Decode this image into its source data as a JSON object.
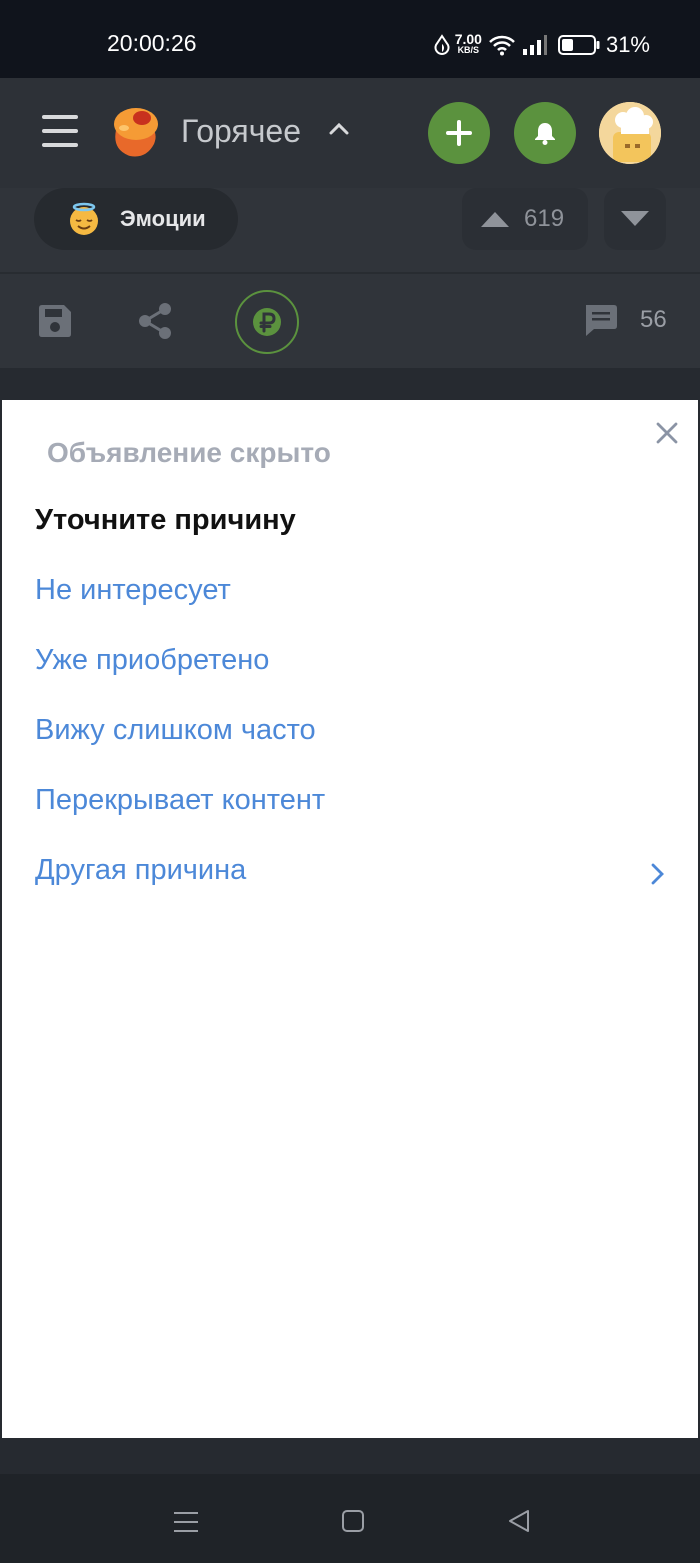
{
  "status_bar": {
    "time": "20:00:26",
    "net_speed_value": "7.00",
    "net_speed_unit": "KB/S",
    "battery_percent": "31%",
    "icons": [
      "data-saver-icon",
      "wifi-icon",
      "signal-icon",
      "battery-icon"
    ]
  },
  "header": {
    "menu_icon": "hamburger-icon",
    "logo_icon": "pikabu-logo-icon",
    "title": "Горячее",
    "title_icon": "chevron-up-icon",
    "add_icon": "plus-icon",
    "notifications_icon": "bell-icon",
    "avatar_icon": "user-avatar-icon",
    "accent_color": "#5b923e"
  },
  "post": {
    "tag": {
      "emoji_icon": "angel-face-icon",
      "label": "Эмоции"
    },
    "rating": "619",
    "actions": {
      "save_icon": "save-icon",
      "share_icon": "share-icon",
      "donate_icon": "ruble-icon",
      "comments_icon": "comment-icon",
      "comments_count": "56"
    }
  },
  "ad_dialog": {
    "title": "Объявление скрыто",
    "heading": "Уточните причину",
    "close_icon": "close-icon",
    "reasons": [
      {
        "label": "Не интересует"
      },
      {
        "label": "Уже приобретено"
      },
      {
        "label": "Вижу слишком часто"
      },
      {
        "label": "Перекрывает контент"
      },
      {
        "label": "Другая причина",
        "icon": "chevron-right-icon"
      }
    ],
    "link_color": "#4c88d8"
  },
  "nav_bar": {
    "icons": [
      "recent-apps-icon",
      "home-icon",
      "back-icon"
    ]
  }
}
